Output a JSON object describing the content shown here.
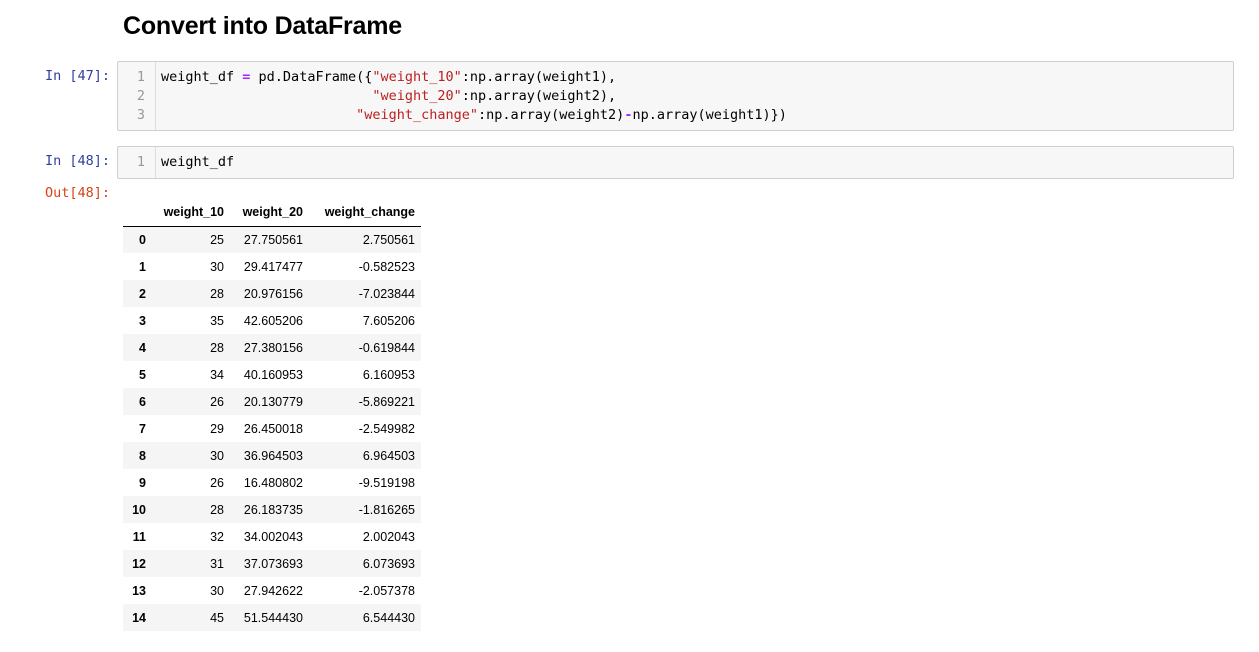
{
  "heading": "Convert into DataFrame",
  "cells": [
    {
      "prompt": "In [47]:",
      "lines": [
        {
          "num": "1"
        },
        {
          "num": "2"
        },
        {
          "num": "3"
        }
      ]
    },
    {
      "prompt": "In [48]:",
      "lines": [
        {
          "num": "1",
          "code": "weight_df"
        }
      ]
    }
  ],
  "code47": {
    "l1_a": "weight_df ",
    "l1_op": "=",
    "l1_b": " pd.DataFrame({",
    "l1_s": "\"weight_10\"",
    "l1_c": ":np.array(weight1),",
    "l2_pad": "                          ",
    "l2_s": "\"weight_20\"",
    "l2_c": ":np.array(weight2),",
    "l3_pad": "                        ",
    "l3_s": "\"weight_change\"",
    "l3_c": ":np.array(weight2)",
    "l3_op": "-",
    "l3_d": "np.array(weight1)})"
  },
  "output": {
    "prompt": "Out[48]:",
    "columns": [
      "",
      "weight_10",
      "weight_20",
      "weight_change"
    ],
    "rows": [
      [
        "0",
        "25",
        "27.750561",
        "2.750561"
      ],
      [
        "1",
        "30",
        "29.417477",
        "-0.582523"
      ],
      [
        "2",
        "28",
        "20.976156",
        "-7.023844"
      ],
      [
        "3",
        "35",
        "42.605206",
        "7.605206"
      ],
      [
        "4",
        "28",
        "27.380156",
        "-0.619844"
      ],
      [
        "5",
        "34",
        "40.160953",
        "6.160953"
      ],
      [
        "6",
        "26",
        "20.130779",
        "-5.869221"
      ],
      [
        "7",
        "29",
        "26.450018",
        "-2.549982"
      ],
      [
        "8",
        "30",
        "36.964503",
        "6.964503"
      ],
      [
        "9",
        "26",
        "16.480802",
        "-9.519198"
      ],
      [
        "10",
        "28",
        "26.183735",
        "-1.816265"
      ],
      [
        "11",
        "32",
        "34.002043",
        "2.002043"
      ],
      [
        "12",
        "31",
        "37.073693",
        "6.073693"
      ],
      [
        "13",
        "30",
        "27.942622",
        "-2.057378"
      ],
      [
        "14",
        "45",
        "51.544430",
        "6.544430"
      ]
    ]
  }
}
